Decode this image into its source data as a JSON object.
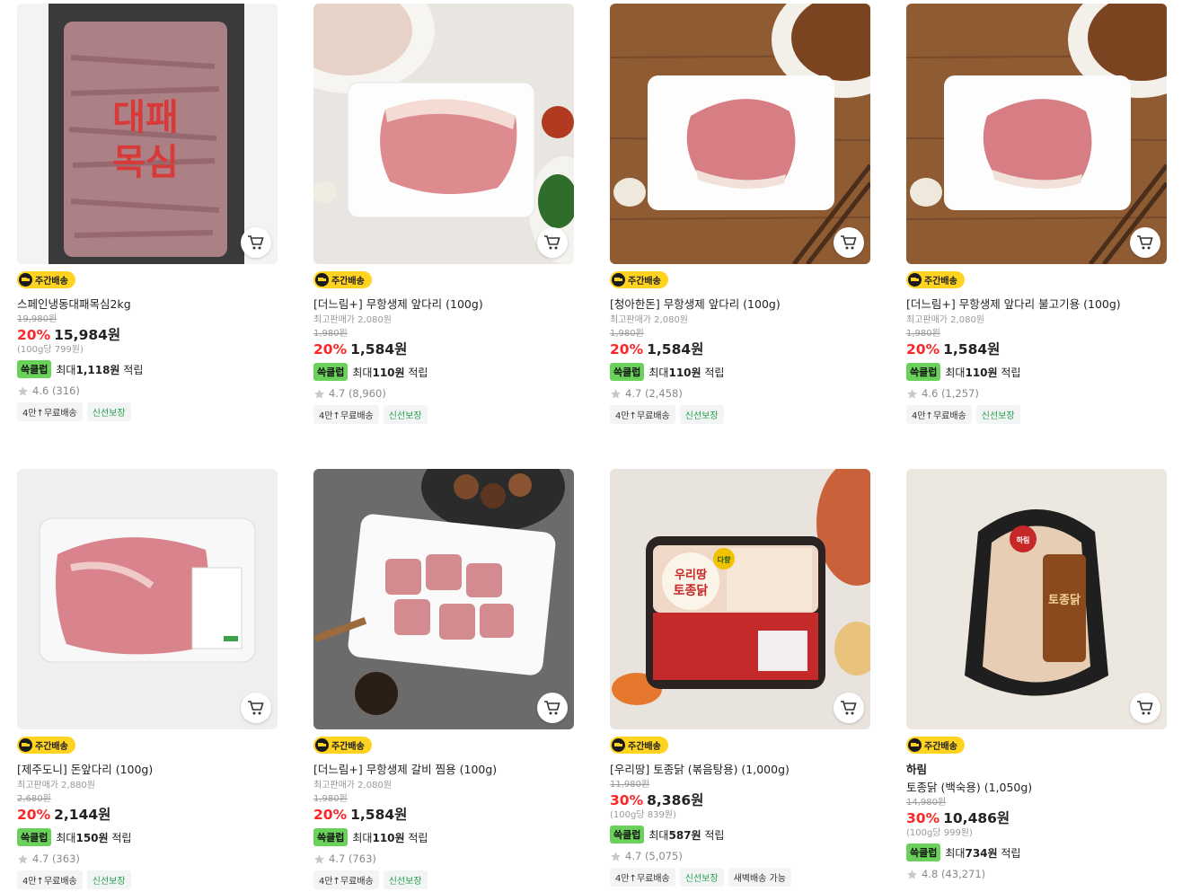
{
  "colors": {
    "discount": "#fa2828",
    "badge": "#ffd31f",
    "reward_tag": "#6ad15a",
    "fresh": "#25a04a"
  },
  "products": [
    {
      "badge": "주간배송",
      "name": "스페인냉동대패목심2kg",
      "original_price": "19,980원",
      "discount": "20%",
      "price": "15,984원",
      "unit_price": "(100g당 799원)",
      "reward_tag": "쓱클럽",
      "reward_prefix": "최대",
      "reward_amount": "1,118원",
      "reward_suffix": "적립",
      "rating": "4.6 (316)",
      "chips": [
        "4만↑무료배송",
        "신선보장"
      ]
    },
    {
      "badge": "주간배송",
      "name": "[더느림+] 무항생제 앞다리 (100g)",
      "max_price": "최고판매가 2,080원",
      "original_price": "1,980원",
      "discount": "20%",
      "price": "1,584원",
      "reward_tag": "쓱클럽",
      "reward_prefix": "최대",
      "reward_amount": "110원",
      "reward_suffix": "적립",
      "rating": "4.7 (8,960)",
      "chips": [
        "4만↑무료배송",
        "신선보장"
      ]
    },
    {
      "badge": "주간배송",
      "name": "[청아한돈] 무항생제 앞다리 (100g)",
      "max_price": "최고판매가 2,080원",
      "original_price": "1,980원",
      "discount": "20%",
      "price": "1,584원",
      "reward_tag": "쓱클럽",
      "reward_prefix": "최대",
      "reward_amount": "110원",
      "reward_suffix": "적립",
      "rating": "4.7 (2,458)",
      "chips": [
        "4만↑무료배송",
        "신선보장"
      ]
    },
    {
      "badge": "주간배송",
      "name": "[더느림+] 무항생제 앞다리 불고기용 (100g)",
      "max_price": "최고판매가 2,080원",
      "original_price": "1,980원",
      "discount": "20%",
      "price": "1,584원",
      "reward_tag": "쓱클럽",
      "reward_prefix": "최대",
      "reward_amount": "110원",
      "reward_suffix": "적립",
      "rating": "4.6 (1,257)",
      "chips": [
        "4만↑무료배송",
        "신선보장"
      ]
    },
    {
      "badge": "주간배송",
      "name": "[제주도니] 돈앞다리 (100g)",
      "max_price": "최고판매가 2,880원",
      "original_price": "2,680원",
      "discount": "20%",
      "price": "2,144원",
      "reward_tag": "쓱클럽",
      "reward_prefix": "최대",
      "reward_amount": "150원",
      "reward_suffix": "적립",
      "rating": "4.7 (363)",
      "chips": [
        "4만↑무료배송",
        "신선보장"
      ]
    },
    {
      "badge": "주간배송",
      "name": "[더느림+] 무항생제 갈비 찜용 (100g)",
      "max_price": "최고판매가 2,080원",
      "original_price": "1,980원",
      "discount": "20%",
      "price": "1,584원",
      "reward_tag": "쓱클럽",
      "reward_prefix": "최대",
      "reward_amount": "110원",
      "reward_suffix": "적립",
      "rating": "4.7 (763)",
      "chips": [
        "4만↑무료배송",
        "신선보장"
      ]
    },
    {
      "badge": "주간배송",
      "name": "[우리땅] 토종닭 (볶음탕용) (1,000g)",
      "original_price": "11,980원",
      "discount": "30%",
      "price": "8,386원",
      "unit_price": "(100g당 839원)",
      "reward_tag": "쓱클럽",
      "reward_prefix": "최대",
      "reward_amount": "587원",
      "reward_suffix": "적립",
      "rating": "4.7 (5,075)",
      "chips": [
        "4만↑무료배송",
        "신선보장",
        "새벽배송 가능"
      ]
    },
    {
      "badge": "주간배송",
      "brand": "하림",
      "name": "토종닭 (백숙용) (1,050g)",
      "original_price": "14,980원",
      "discount": "30%",
      "price": "10,486원",
      "unit_price": "(100g당 999원)",
      "reward_tag": "쓱클럽",
      "reward_prefix": "최대",
      "reward_amount": "734원",
      "reward_suffix": "적립",
      "rating": "4.8 (43,271)",
      "chips": []
    }
  ],
  "image_labels": {
    "p1_bag_text_1": "대패",
    "p1_bag_text_2": "목심",
    "p7_brand": "우리땅",
    "p7_product": "토종닭",
    "p7_tag": "다향",
    "p8_brand": "하림",
    "p8_product": "토종닭"
  }
}
